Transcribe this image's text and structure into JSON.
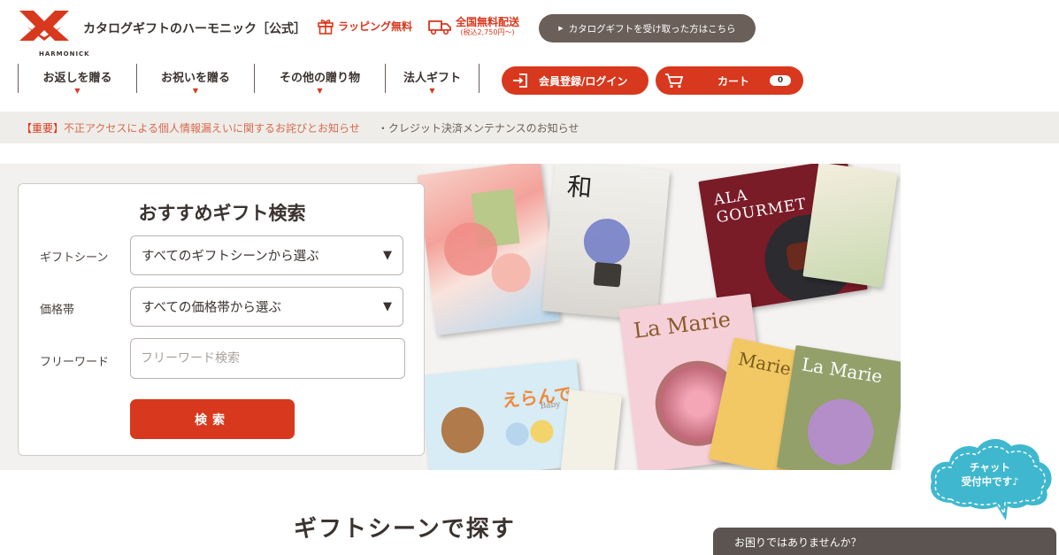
{
  "header": {
    "logo_text": "HARMONICK",
    "site_name": "カタログギフトのハーモニック［公式］",
    "wrapping_label": "ラッピング無料",
    "shipping_label": "全国無料配送",
    "shipping_note": "(税込2,750円～)",
    "catalog_button": "カタログギフトを受け取った方はこちら"
  },
  "nav": {
    "items": [
      {
        "label": "お返しを贈る"
      },
      {
        "label": "お祝いを贈る"
      },
      {
        "label": "その他の贈り物"
      },
      {
        "label": "法人ギフト"
      }
    ],
    "login_label": "会員登録/ログイン",
    "cart_label": "カート",
    "cart_count": "0"
  },
  "notices": {
    "important_tag": "【重要】",
    "important_text": "不正アクセスによる個人情報漏えいに関するお詫びとお知らせ",
    "second": "・クレジット決済メンテナンスのお知らせ"
  },
  "search": {
    "title": "おすすめギフト検索",
    "scene_label": "ギフトシーン",
    "scene_value": "すべてのギフトシーンから選ぶ",
    "price_label": "価格帯",
    "price_value": "すべての価格帯から選ぶ",
    "keyword_label": "フリーワード",
    "keyword_placeholder": "フリーワード検索",
    "button_label": "検索"
  },
  "hero": {
    "book_wa": "和",
    "book_ala_gourmet": "ALA GOURMET",
    "book_la_marie": "La Marie",
    "book_la_marie_2": "Marie",
    "book_la_marie_3": "La Marie",
    "book_erande": "えらんで",
    "book_baby": "Baby"
  },
  "section": {
    "title": "ギフトシーンで探す"
  },
  "chat": {
    "line1": "チャット",
    "line2": "受付中です♪"
  },
  "help": {
    "label": "お困りではありませんか？"
  },
  "colors": {
    "brand_red": "#d8381d",
    "dark_brown": "#6a5f59",
    "chat_blue": "#3fb8cf"
  }
}
